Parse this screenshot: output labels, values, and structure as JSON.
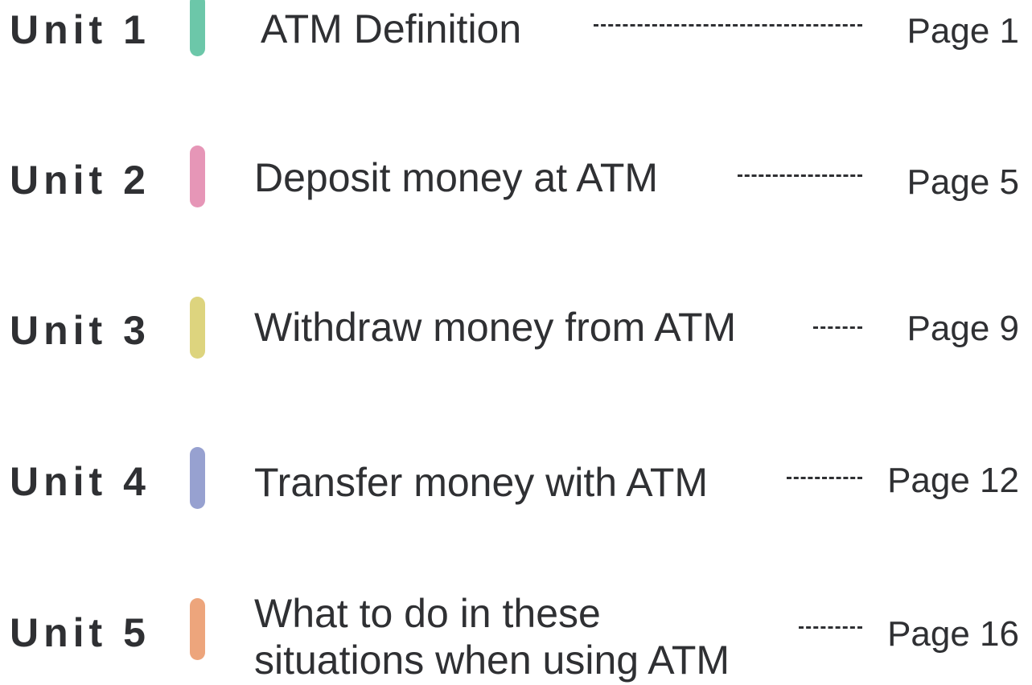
{
  "units": [
    {
      "unit_label": "Unit 1",
      "title": "ATM Definition",
      "page": "Page 1",
      "bar_color": "#6cc7a9"
    },
    {
      "unit_label": "Unit 2",
      "title": "Deposit money at ATM",
      "page": "Page 5",
      "bar_color": "#e696b7"
    },
    {
      "unit_label": "Unit 3",
      "title": "Withdraw money from ATM",
      "page": "Page 9",
      "bar_color": "#ddd47e"
    },
    {
      "unit_label": "Unit 4",
      "title": "Transfer money with ATM",
      "page": "Page 12",
      "bar_color": "#97a1d0"
    },
    {
      "unit_label": "Unit 5",
      "title_line1": "What to do in these",
      "title_line2": "situations when using ATM",
      "page": "Page 16",
      "bar_color": "#eda57c"
    }
  ]
}
